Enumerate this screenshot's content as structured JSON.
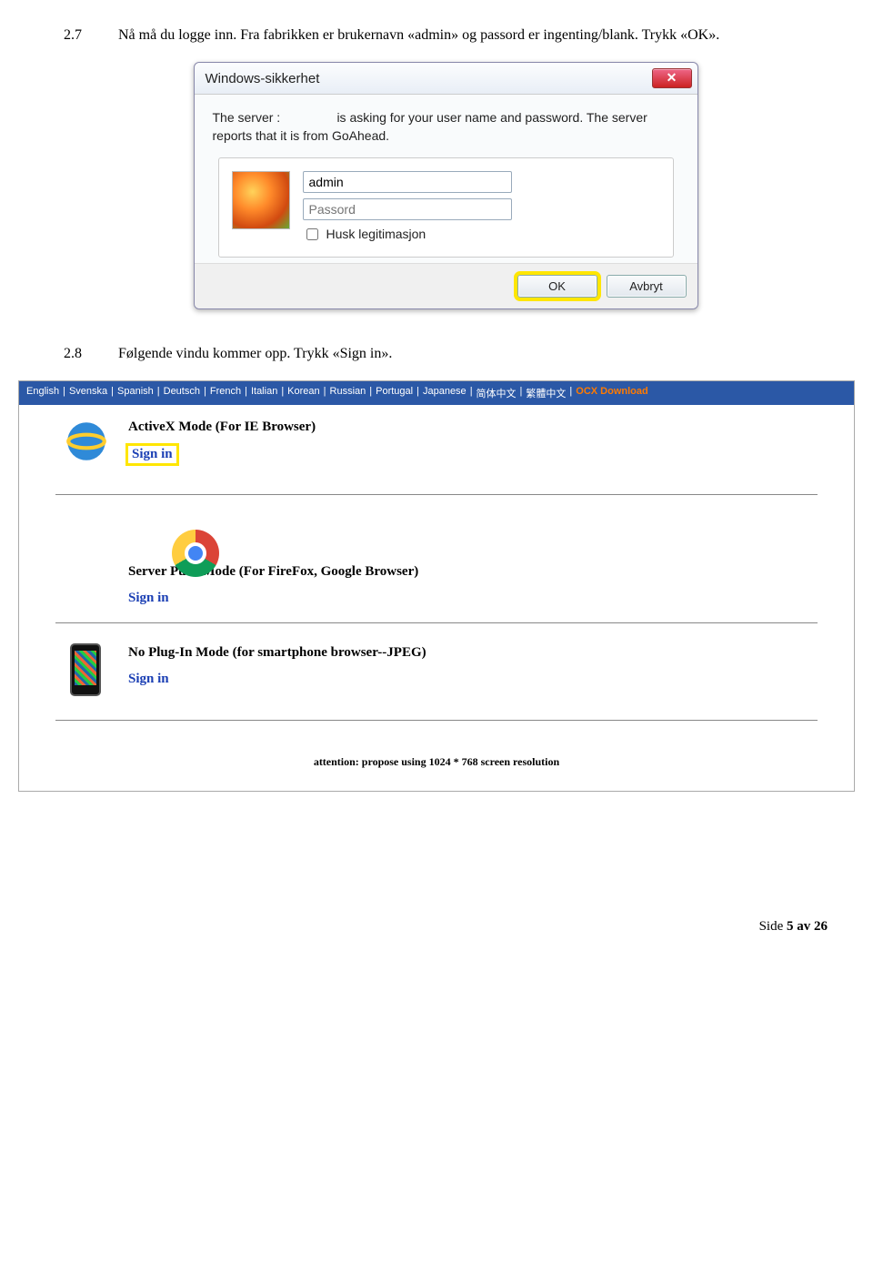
{
  "step27": {
    "num": "2.7",
    "text": "Nå må du logge inn. Fra fabrikken er brukernavn «admin» og passord er ingenting/blank. Trykk «OK»."
  },
  "dialog": {
    "title": "Windows-sikkerhet",
    "prompt_line1": "The server :",
    "prompt_line2": "is asking for your user name and password. The server reports that it is from GoAhead.",
    "username_value": "admin",
    "password_placeholder": "Passord",
    "remember_label": "Husk legitimasjon",
    "ok_label": "OK",
    "cancel_label": "Avbryt"
  },
  "step28": {
    "num": "2.8",
    "text": "Følgende vindu kommer opp. Trykk «Sign in»."
  },
  "web": {
    "langs": [
      "English",
      "Svenska",
      "Spanish",
      "Deutsch",
      "French",
      "Italian",
      "Korean",
      "Russian",
      "Portugal",
      "Japanese",
      "简体中文",
      "繁體中文"
    ],
    "ocx": "OCX Download",
    "modes": [
      {
        "title": "ActiveX Mode (For IE Browser)",
        "signin": "Sign in",
        "highlight": true
      },
      {
        "title": "Server Push Mode (For FireFox, Google Browser)",
        "signin": "Sign in",
        "highlight": false
      },
      {
        "title": "No Plug-In Mode (for smartphone browser--JPEG)",
        "signin": "Sign in",
        "highlight": false
      }
    ],
    "attention": "attention: propose using 1024 * 768 screen resolution"
  },
  "footer": {
    "side": "Side",
    "page_of": "5 av 26"
  }
}
